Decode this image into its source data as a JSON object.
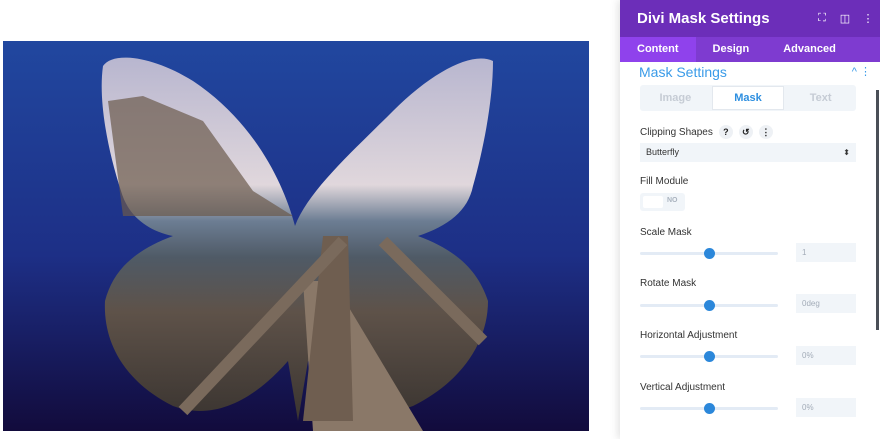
{
  "panel": {
    "title": "Divi Mask Settings",
    "header_icons": [
      "focus-icon",
      "sidebar-icon",
      "more-icon"
    ],
    "tabs": [
      {
        "label": "Content"
      },
      {
        "label": "Design"
      },
      {
        "label": "Advanced"
      }
    ],
    "section_title": "Mask Settings",
    "segments": [
      {
        "label": "Image"
      },
      {
        "label": "Mask"
      },
      {
        "label": "Text"
      }
    ],
    "clipping_label": "Clipping Shapes",
    "clipping_value": "Butterfly",
    "fill_label": "Fill Module",
    "fill_value": "NO",
    "sliders": [
      {
        "label": "Scale Mask",
        "value": "1",
        "position": 0.5
      },
      {
        "label": "Rotate Mask",
        "value": "0deg",
        "position": 0.5
      },
      {
        "label": "Horizontal Adjustment",
        "value": "0%",
        "position": 0.5
      },
      {
        "label": "Vertical Adjustment",
        "value": "0%",
        "position": 0.5
      }
    ]
  },
  "colors": {
    "header": "#6c2eb9",
    "tabs": "#7e3bd0",
    "accent": "#2b87da"
  }
}
